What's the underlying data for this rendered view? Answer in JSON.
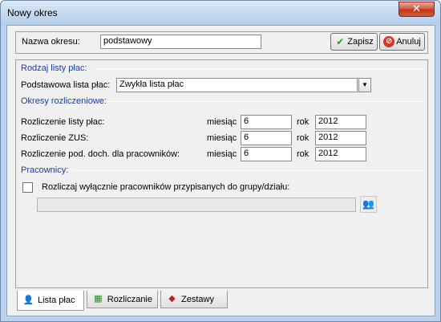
{
  "window": {
    "title": "Nowy okres",
    "close_label": "✕"
  },
  "period": {
    "name_label": "Nazwa okresu:",
    "name_value": "podstawowy"
  },
  "actions": {
    "save_label": "Zapisz",
    "cancel_label": "Anuluj"
  },
  "payroll_type": {
    "section_label": "Rodzaj listy płac:",
    "base_list_label": "Podstawowa lista płac:",
    "base_list_value": "Zwykła lista płac"
  },
  "settlement_periods": {
    "section_label": "Okresy rozliczeniowe:",
    "rows": [
      {
        "label": "Rozliczenie listy płac:",
        "month_label": "miesiąc",
        "month": "6",
        "year_label": "rok",
        "year": "2012"
      },
      {
        "label": "Rozliczenie ZUS:",
        "month_label": "miesiąc",
        "month": "6",
        "year_label": "rok",
        "year": "2012"
      },
      {
        "label": "Rozliczenie pod. doch. dla pracowników:",
        "month_label": "miesiąc",
        "month": "6",
        "year_label": "rok",
        "year": "2012"
      }
    ]
  },
  "employees": {
    "section_label": "Pracownicy:",
    "only_group_label": "Rozliczaj wyłącznie pracowników przypisanych do grupy/działu:",
    "only_group_checked": false,
    "group_value": ""
  },
  "tabs": [
    {
      "label": "Lista płac",
      "active": true,
      "icon": "person-icon"
    },
    {
      "label": "Rozliczanie",
      "active": false,
      "icon": "spreadsheet-icon"
    },
    {
      "label": "Zestawy",
      "active": false,
      "icon": "shapes-icon"
    }
  ],
  "colors": {
    "section_label": "#1c3e9c",
    "titlebar": "#c4d8ee",
    "dialog_bg": "#f0f0f0"
  }
}
